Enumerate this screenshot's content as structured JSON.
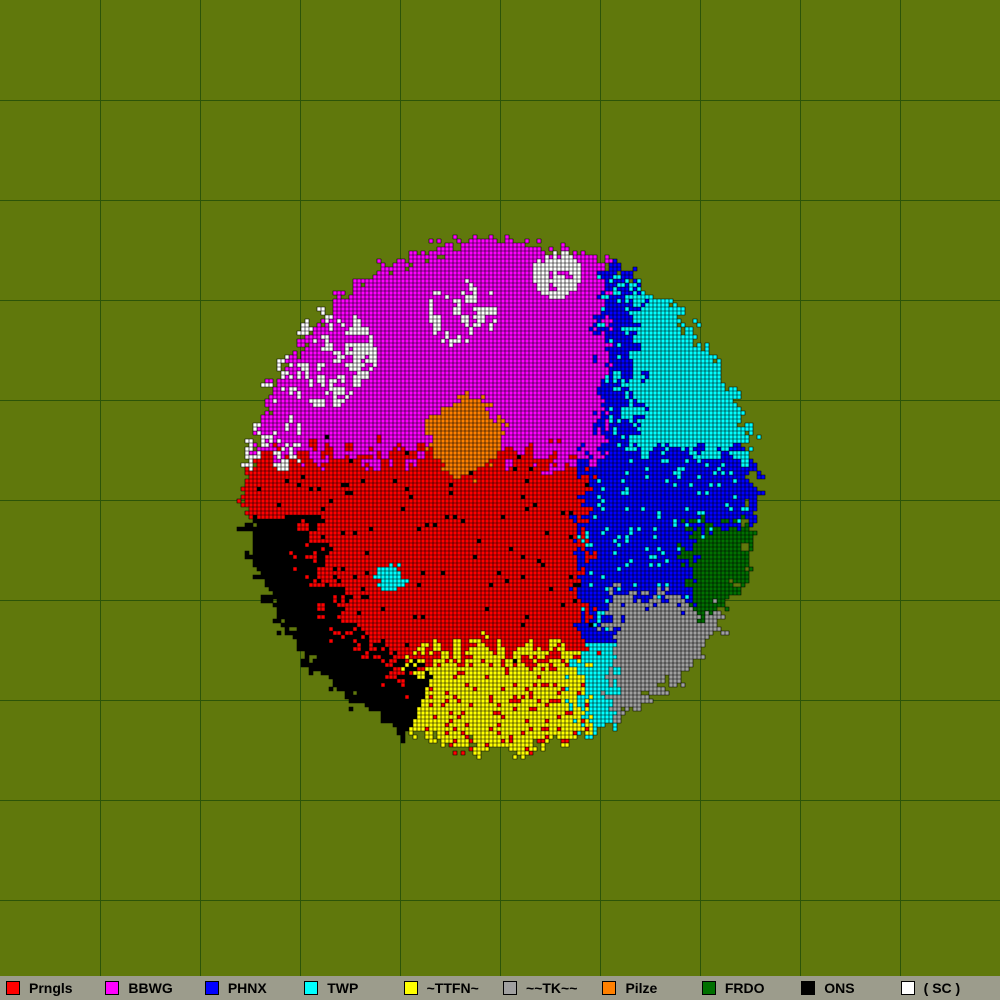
{
  "colors": {
    "background": "#60780c",
    "grid": "#2c5408",
    "outline": "#000000"
  },
  "legend": [
    {
      "label": "Prngls",
      "color": "#ff0000"
    },
    {
      "label": "BBWG",
      "color": "#ff00ff"
    },
    {
      "label": "PHNX",
      "color": "#0000ff"
    },
    {
      "label": "TWP",
      "color": "#00ffff"
    },
    {
      "label": "~TTFN~",
      "color": "#ffff00"
    },
    {
      "label": "~~TK~~",
      "color": "#a0a0a0"
    },
    {
      "label": "Pilze",
      "color": "#ff8000"
    },
    {
      "label": "FRDO",
      "color": "#007000"
    },
    {
      "label": "ONS",
      "color": "#000000"
    },
    {
      "label": "( SC )",
      "color": "#ffffff"
    }
  ]
}
